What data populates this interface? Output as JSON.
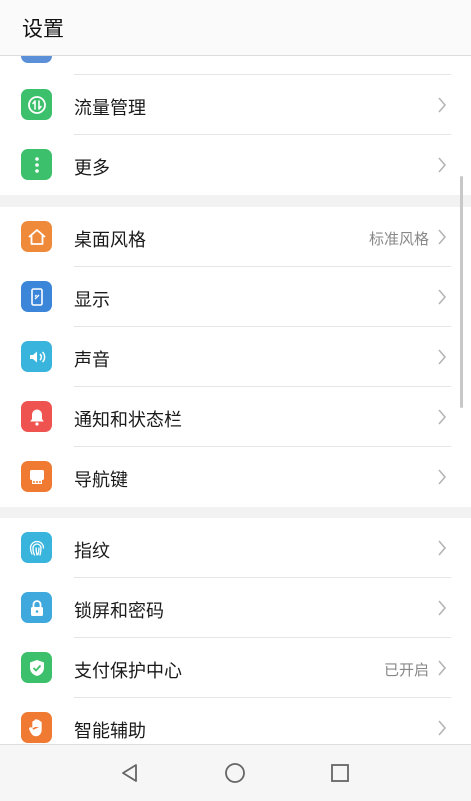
{
  "header": {
    "title": "设置"
  },
  "icon_colors": {
    "data-usage": "#3cc06b",
    "more": "#3cc06b",
    "home-style": "#f08a3b",
    "display": "#3b86d9",
    "sound": "#39b4dc",
    "notification": "#ef5350",
    "nav-key": "#f07a32",
    "fingerprint": "#39b4dc",
    "lock": "#3fa8dc",
    "payment": "#3cc06b",
    "assist": "#f07a32"
  },
  "groups": [
    {
      "items": [
        {
          "label": "流量管理",
          "icon": "data-usage-icon"
        },
        {
          "label": "更多",
          "icon": "more-icon"
        }
      ]
    },
    {
      "items": [
        {
          "label": "桌面风格",
          "value": "标准风格",
          "icon": "home-style-icon"
        },
        {
          "label": "显示",
          "icon": "display-icon"
        },
        {
          "label": "声音",
          "icon": "sound-icon"
        },
        {
          "label": "通知和状态栏",
          "icon": "notification-icon"
        },
        {
          "label": "导航键",
          "icon": "nav-key-icon"
        }
      ]
    },
    {
      "items": [
        {
          "label": "指纹",
          "icon": "fingerprint-icon"
        },
        {
          "label": "锁屏和密码",
          "icon": "lock-icon"
        },
        {
          "label": "支付保护中心",
          "value": "已开启",
          "icon": "shield-check-icon"
        },
        {
          "label": "智能辅助",
          "icon": "hand-icon"
        }
      ]
    }
  ],
  "navbar": {
    "buttons": [
      "back-icon",
      "home-icon",
      "recents-icon"
    ]
  }
}
